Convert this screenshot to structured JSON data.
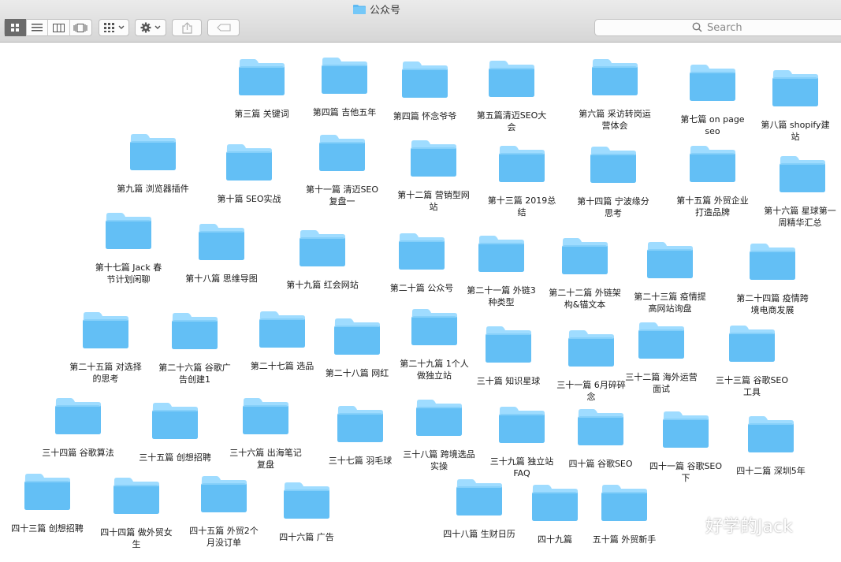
{
  "window": {
    "title": "公众号"
  },
  "toolbar": {
    "view_modes": [
      "icon-view",
      "list-view",
      "column-view",
      "cover-flow-view"
    ],
    "active_view": "icon-view",
    "arrange_icon": "grid-icon",
    "action_icon": "gear-icon",
    "share_icon": "share-icon",
    "tag_icon": "tag-icon"
  },
  "search": {
    "placeholder": "Search"
  },
  "colors": {
    "folder_top": "#9fdcff",
    "folder_body": "#63bff5",
    "active_segment": "#6b6b6b"
  },
  "folders": [
    {
      "label": "第三篇 关键词"
    },
    {
      "label": "第四篇 吉他五年"
    },
    {
      "label": "第四篇 怀念爷爷"
    },
    {
      "label": "第五篇清迈SEO大\n会"
    },
    {
      "label": "第六篇 采访转岗运\n营体会"
    },
    {
      "label": "第七篇 on page\nseo"
    },
    {
      "label": "第八篇 shopify建\n站"
    },
    {
      "label": "第九篇 浏览器插件"
    },
    {
      "label": "第十篇 SEO实战"
    },
    {
      "label": "第十一篇 清迈SEO\n复盘一"
    },
    {
      "label": "第十二篇 营销型网\n站"
    },
    {
      "label": "第十三篇 2019总\n结"
    },
    {
      "label": "第十四篇 宁波缘分\n思考"
    },
    {
      "label": "第十五篇 外贸企业\n打造品牌"
    },
    {
      "label": "第十六篇 星球第一\n周精华汇总"
    },
    {
      "label": "第十七篇 Jack 春\n节计划闲聊"
    },
    {
      "label": "第十八篇 思维导图"
    },
    {
      "label": "第十九篇 红会网站"
    },
    {
      "label": "第二十篇 公众号"
    },
    {
      "label": "第二十一篇 外链3\n种类型"
    },
    {
      "label": "第二十二篇 外链架\n构&锚文本"
    },
    {
      "label": "第二十三篇 疫情提\n高网站询盘"
    },
    {
      "label": "第二十四篇 疫情跨\n境电商发展"
    },
    {
      "label": "第二十五篇 对选择\n的思考"
    },
    {
      "label": "第二十六篇 谷歌广\n告创建1"
    },
    {
      "label": "第二十七篇 选品"
    },
    {
      "label": "第二十八篇 网红"
    },
    {
      "label": "第二十九篇 1个人\n做独立站"
    },
    {
      "label": "三十篇 知识星球"
    },
    {
      "label": "三十一篇 6月碎碎\n念"
    },
    {
      "label": "三十二篇 海外运营\n面试"
    },
    {
      "label": "三十三篇 谷歌SEO\n工具"
    },
    {
      "label": "三十四篇 谷歌算法"
    },
    {
      "label": "三十五篇 创想招聘"
    },
    {
      "label": "三十六篇 出海笔记\n复盘"
    },
    {
      "label": "三十七篇 羽毛球"
    },
    {
      "label": "三十八篇 跨境选品\n实操"
    },
    {
      "label": "三十九篇 独立站\nFAQ"
    },
    {
      "label": "四十篇 谷歌SEO"
    },
    {
      "label": "四十一篇 谷歌SEO\n下"
    },
    {
      "label": "四十二篇 深圳5年"
    },
    {
      "label": "四十三篇 创想招聘"
    },
    {
      "label": "四十四篇 做外贸女\n生"
    },
    {
      "label": "四十五篇 外贸2个\n月没订单"
    },
    {
      "label": "四十六篇 广告"
    },
    {
      "label": "四十八篇 生财日历"
    },
    {
      "label": "四十九篇"
    },
    {
      "label": "五十篇 外贸新手"
    }
  ],
  "watermark": {
    "text": "好学的Jack",
    "icon": "wechat-icon"
  }
}
